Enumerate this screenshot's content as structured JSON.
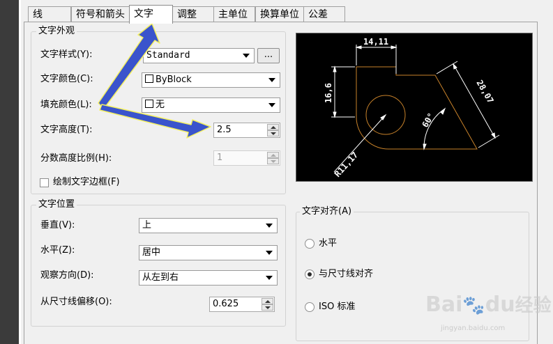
{
  "tabs": [
    {
      "label": "线",
      "active": false
    },
    {
      "label": "符号和箭头",
      "active": false
    },
    {
      "label": "文字",
      "active": true
    },
    {
      "label": "调整",
      "active": false
    },
    {
      "label": "主单位",
      "active": false
    },
    {
      "label": "换算单位",
      "active": false
    },
    {
      "label": "公差",
      "active": false
    }
  ],
  "appearance": {
    "title": "文字外观",
    "style_label": "文字样式(Y):",
    "style_value": "Standard",
    "browse_label": "...",
    "color_label": "文字颜色(C):",
    "color_value": "ByBlock",
    "fill_label": "填充颜色(L):",
    "fill_value": "无",
    "height_label": "文字高度(T):",
    "height_value": "2.5",
    "fraction_label": "分数高度比例(H):",
    "fraction_value": "1",
    "frame_label": "绘制文字边框(F)",
    "frame_checked": false
  },
  "placement": {
    "title": "文字位置",
    "vertical_label": "垂直(V):",
    "vertical_value": "上",
    "horizontal_label": "水平(Z):",
    "horizontal_value": "居中",
    "view_label": "观察方向(D):",
    "view_value": "从左到右",
    "offset_label": "从尺寸线偏移(O):",
    "offset_value": "0.625"
  },
  "alignment": {
    "title": "文字对齐(A)",
    "options": [
      {
        "label": "水平",
        "checked": false
      },
      {
        "label": "与尺寸线对齐",
        "checked": true
      },
      {
        "label": "ISO 标准",
        "checked": false
      }
    ]
  },
  "preview": {
    "dim_top": "14,11",
    "dim_left": "16,6",
    "dim_slant": "28,07",
    "dim_angle": "60°",
    "dim_radius": "R11,17",
    "colors": {
      "outline": "#c8822a",
      "dims": "#ffffff",
      "background": "#000000"
    }
  },
  "annotation_colors": {
    "arrow": "#3a54cc",
    "outline": "#f4f060"
  },
  "watermark": {
    "brand": "Bai",
    "brand2": "du",
    "brand3": "经验",
    "url": "jingyan.baidu.com"
  }
}
